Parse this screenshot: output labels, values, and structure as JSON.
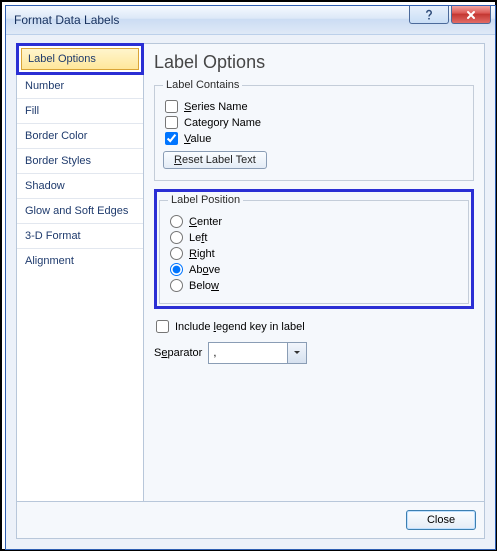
{
  "window": {
    "title": "Format Data Labels"
  },
  "sidebar": {
    "items": [
      {
        "label": "Label Options",
        "selected": true
      },
      {
        "label": "Number"
      },
      {
        "label": "Fill"
      },
      {
        "label": "Border Color"
      },
      {
        "label": "Border Styles"
      },
      {
        "label": "Shadow"
      },
      {
        "label": "Glow and Soft Edges"
      },
      {
        "label": "3-D Format"
      },
      {
        "label": "Alignment"
      }
    ]
  },
  "panel": {
    "heading": "Label Options",
    "contains_legend": "Label Contains",
    "series_name_label": "Series Name",
    "series_name_checked": false,
    "category_name_label": "Category Name",
    "category_name_checked": false,
    "value_label": "Value",
    "value_checked": true,
    "reset_label": "Reset Label Text",
    "position_legend": "Label Position",
    "pos_center": "Center",
    "pos_left": "Left",
    "pos_right": "Right",
    "pos_above": "Above",
    "pos_below": "Below",
    "pos_selected": "Above",
    "include_legend_label": "Include legend key in label",
    "include_legend_checked": false,
    "separator_label": "Separator",
    "separator_value": ","
  },
  "footer": {
    "close_label": "Close"
  }
}
